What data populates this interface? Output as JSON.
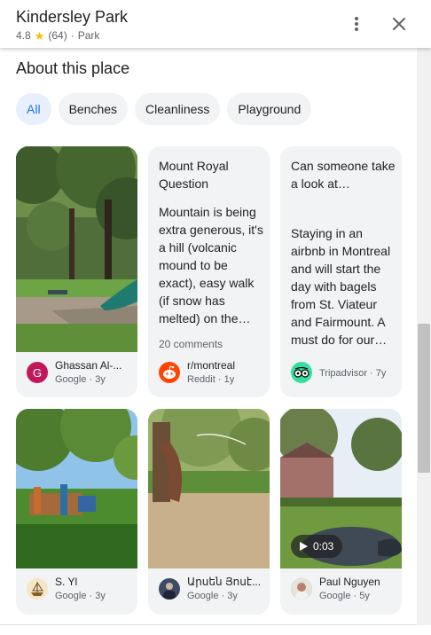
{
  "place": {
    "name": "Kindersley Park",
    "rating": "4.8",
    "reviews": "(64)",
    "separator": "·",
    "category": "Park"
  },
  "icons": {
    "star": "star-icon",
    "more": "more-vert-icon",
    "close": "close-icon"
  },
  "about": {
    "title": "About this place",
    "chips": [
      "All",
      "Benches",
      "Cleanliness",
      "Playground"
    ],
    "selected_chip": "All"
  },
  "cards": [
    {
      "kind": "photo",
      "author": "Ghassan Al-...",
      "source": "Google · 3y",
      "avatar_letter": "G",
      "avatar_color": "#c2185b"
    },
    {
      "kind": "post",
      "title": "Mount Royal Question",
      "body": "Mountain is being extra generous, it's a hill (volcanic mound to be exact), easy walk (if snow has melted) on the…",
      "comments": "20 comments",
      "author": "r/montreal",
      "source": "Reddit · 1y",
      "avatar_color": "#ff4500"
    },
    {
      "kind": "post",
      "title": "Can someone take a look at…",
      "body": "Staying in an airbnb in Montreal and will start the day with bagels from St. Viateur and Fairmount. A must do for our…",
      "comments": "",
      "author": "Tripadvisor · 7y",
      "source": "",
      "avatar_color": "#34e0a1"
    },
    {
      "kind": "photo",
      "author": "S. Yl",
      "source": "Google · 3y",
      "avatar_color": "#f5e6c8"
    },
    {
      "kind": "photo",
      "author": "Արսեն Յոսէ...",
      "source": "Google · 3y",
      "avatar_color": "#3c4a66"
    },
    {
      "kind": "video",
      "author": "Paul Nguyen",
      "source": "Google · 5y",
      "duration": "0:03",
      "avatar_color": "#9e8e80"
    }
  ],
  "colors": {
    "accent": "#1a73e8",
    "chip_active_bg": "#e8f0fe",
    "card_bg": "#f1f3f4"
  }
}
